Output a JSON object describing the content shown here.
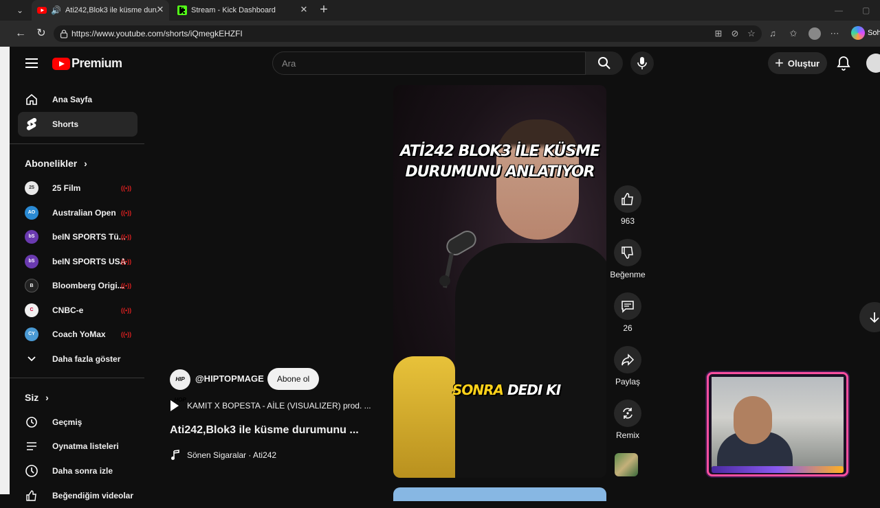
{
  "browser": {
    "tabs": [
      {
        "title": "Ati242,Blok3 ile küsme durum",
        "active": true
      },
      {
        "title": "Stream - Kick Dashboard",
        "active": false
      }
    ],
    "url": "https://www.youtube.com/shorts/iQmegkEHZFI",
    "profile_label": "Soh"
  },
  "youtube": {
    "logo_text": "Premium",
    "search_placeholder": "Ara",
    "create_label": "Oluştur"
  },
  "sidebar": {
    "main": [
      {
        "label": "Ana Sayfa",
        "icon": "home-icon"
      },
      {
        "label": "Shorts",
        "icon": "shorts-icon",
        "active": true
      }
    ],
    "subscriptions_title": "Abonelikler",
    "subscriptions": [
      {
        "label": "25 Film",
        "avatar": "25",
        "color": "#e8e8e8",
        "live": true
      },
      {
        "label": "Australian Open",
        "avatar": "AO",
        "color": "#2a8ad4",
        "live": true
      },
      {
        "label": "beIN SPORTS Tü...",
        "avatar": "bS",
        "color": "#6a3ab0",
        "live": true
      },
      {
        "label": "beIN SPORTS USA",
        "avatar": "bS",
        "color": "#6a3ab0",
        "live": true
      },
      {
        "label": "Bloomberg Origi...",
        "avatar": "B",
        "color": "#222222",
        "live": true
      },
      {
        "label": "CNBC-e",
        "avatar": "C",
        "color": "#f0f0f0",
        "live": true
      },
      {
        "label": "Coach YoMax",
        "avatar": "CY",
        "color": "#4a9ad4",
        "live": true
      }
    ],
    "show_more": "Daha fazla göster",
    "you_title": "Siz",
    "you": [
      {
        "label": "Geçmiş",
        "icon": "history-icon"
      },
      {
        "label": "Oynatma listeleri",
        "icon": "playlists-icon"
      },
      {
        "label": "Daha sonra izle",
        "icon": "watch-later-icon"
      },
      {
        "label": "Beğendiğim videolar",
        "icon": "liked-icon"
      }
    ]
  },
  "short": {
    "caption_top_1": "ATİ242 BLOK3 İLE KÜSME",
    "caption_top_2": "DURUMUNU ANLATIYOR",
    "caption_bottom_yellow": "SONRA",
    "caption_bottom_white": "DEDI KI",
    "channel_avatar": "HIP HOP",
    "channel_handle": "@HIPTOPMAGE",
    "subscribe_label": "Abone ol",
    "music_title": "KAMIT X BOPESTA - AİLE (VISUALIZER) prod. ...",
    "title": "Ati242,Blok3 ile küsme durumunu ...",
    "sound": "Sönen Sigaralar · Ati242"
  },
  "actions": {
    "like_count": "963",
    "dislike_label": "Beğenme",
    "comment_count": "26",
    "share_label": "Paylaş",
    "remix_label": "Remix"
  },
  "colors": {
    "youtube_red": "#ff0000",
    "kick_green": "#53fc18",
    "live_red": "#e02020"
  }
}
